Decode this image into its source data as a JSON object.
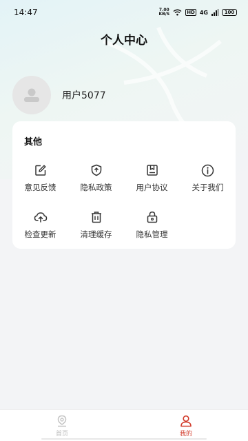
{
  "status_bar": {
    "time": "14:47",
    "net_speed_value": "7.00",
    "net_speed_unit": "KB/S",
    "hd_label": "HD",
    "signal_label": "4G",
    "battery_level": "100"
  },
  "header": {
    "title": "个人中心"
  },
  "profile": {
    "username": "用户5077"
  },
  "other_section": {
    "title": "其他",
    "items": [
      {
        "label": "意见反馈",
        "icon": "edit-icon"
      },
      {
        "label": "隐私政策",
        "icon": "shield-icon"
      },
      {
        "label": "用户协议",
        "icon": "agreement-icon"
      },
      {
        "label": "关于我们",
        "icon": "info-icon"
      },
      {
        "label": "检查更新",
        "icon": "cloud-upload-icon"
      },
      {
        "label": "清理缓存",
        "icon": "trash-icon"
      },
      {
        "label": "隐私管理",
        "icon": "lock-icon"
      }
    ]
  },
  "tabbar": {
    "tabs": [
      {
        "label": "首页",
        "active": false
      },
      {
        "label": "我的",
        "active": true
      }
    ]
  },
  "colors": {
    "accent": "#d23b2b",
    "icon": "#333333",
    "background": "#f3f4f6"
  }
}
